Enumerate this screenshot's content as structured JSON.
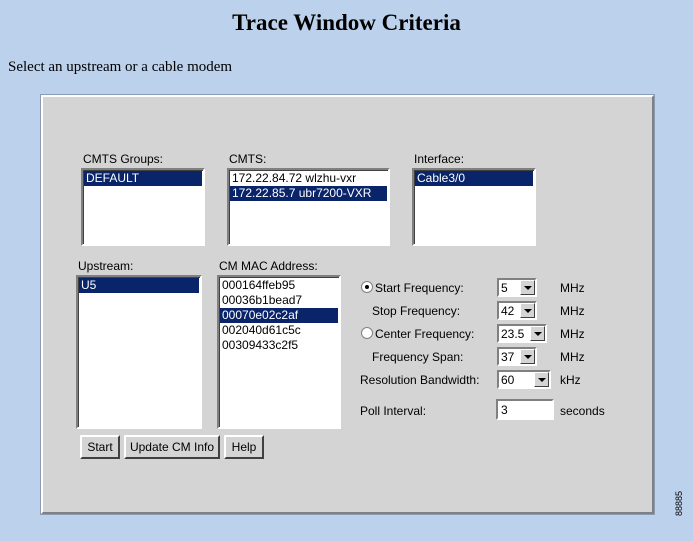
{
  "page": {
    "title": "Trace Window Criteria",
    "instruction": "Select an upstream or a cable modem",
    "figure_id": "88885"
  },
  "cmts_groups": {
    "label": "CMTS Groups:",
    "items": [
      {
        "text": "DEFAULT",
        "selected": true
      }
    ]
  },
  "cmts": {
    "label": "CMTS:",
    "items": [
      {
        "text": "172.22.84.72 wlzhu-vxr",
        "selected": false
      },
      {
        "text": "172.22.85.7 ubr7200-VXR",
        "selected": true
      }
    ]
  },
  "interface": {
    "label": "Interface:",
    "items": [
      {
        "text": "Cable3/0",
        "selected": true
      }
    ]
  },
  "upstream": {
    "label": "Upstream:",
    "items": [
      {
        "text": "U5",
        "selected": true
      }
    ]
  },
  "cm_mac": {
    "label": "CM MAC Address:",
    "items": [
      {
        "text": "000164ffeb95",
        "selected": false
      },
      {
        "text": "00036b1bead7",
        "selected": false
      },
      {
        "text": "00070e02c2af",
        "selected": true
      },
      {
        "text": "002040d61c5c",
        "selected": false
      },
      {
        "text": "00309433c2f5",
        "selected": false
      }
    ]
  },
  "freq": {
    "start": {
      "label": "Start Frequency:",
      "value": "5",
      "unit": "MHz",
      "radio_selected": true
    },
    "stop": {
      "label": "Stop Frequency:",
      "value": "42",
      "unit": "MHz"
    },
    "center": {
      "label": "Center Frequency:",
      "value": "23.5",
      "unit": "MHz",
      "radio_selected": false
    },
    "span": {
      "label": "Frequency Span:",
      "value": "37",
      "unit": "MHz"
    },
    "rbw": {
      "label": "Resolution Bandwidth:",
      "value": "60",
      "unit": "kHz"
    },
    "poll": {
      "label": "Poll Interval:",
      "value": "3",
      "unit": "seconds"
    }
  },
  "buttons": {
    "start": "Start",
    "update": "Update CM Info",
    "help": "Help"
  },
  "colors": {
    "background": "#bcd1ec",
    "panel": "#d4d4d4",
    "selection": "#0a246a"
  }
}
